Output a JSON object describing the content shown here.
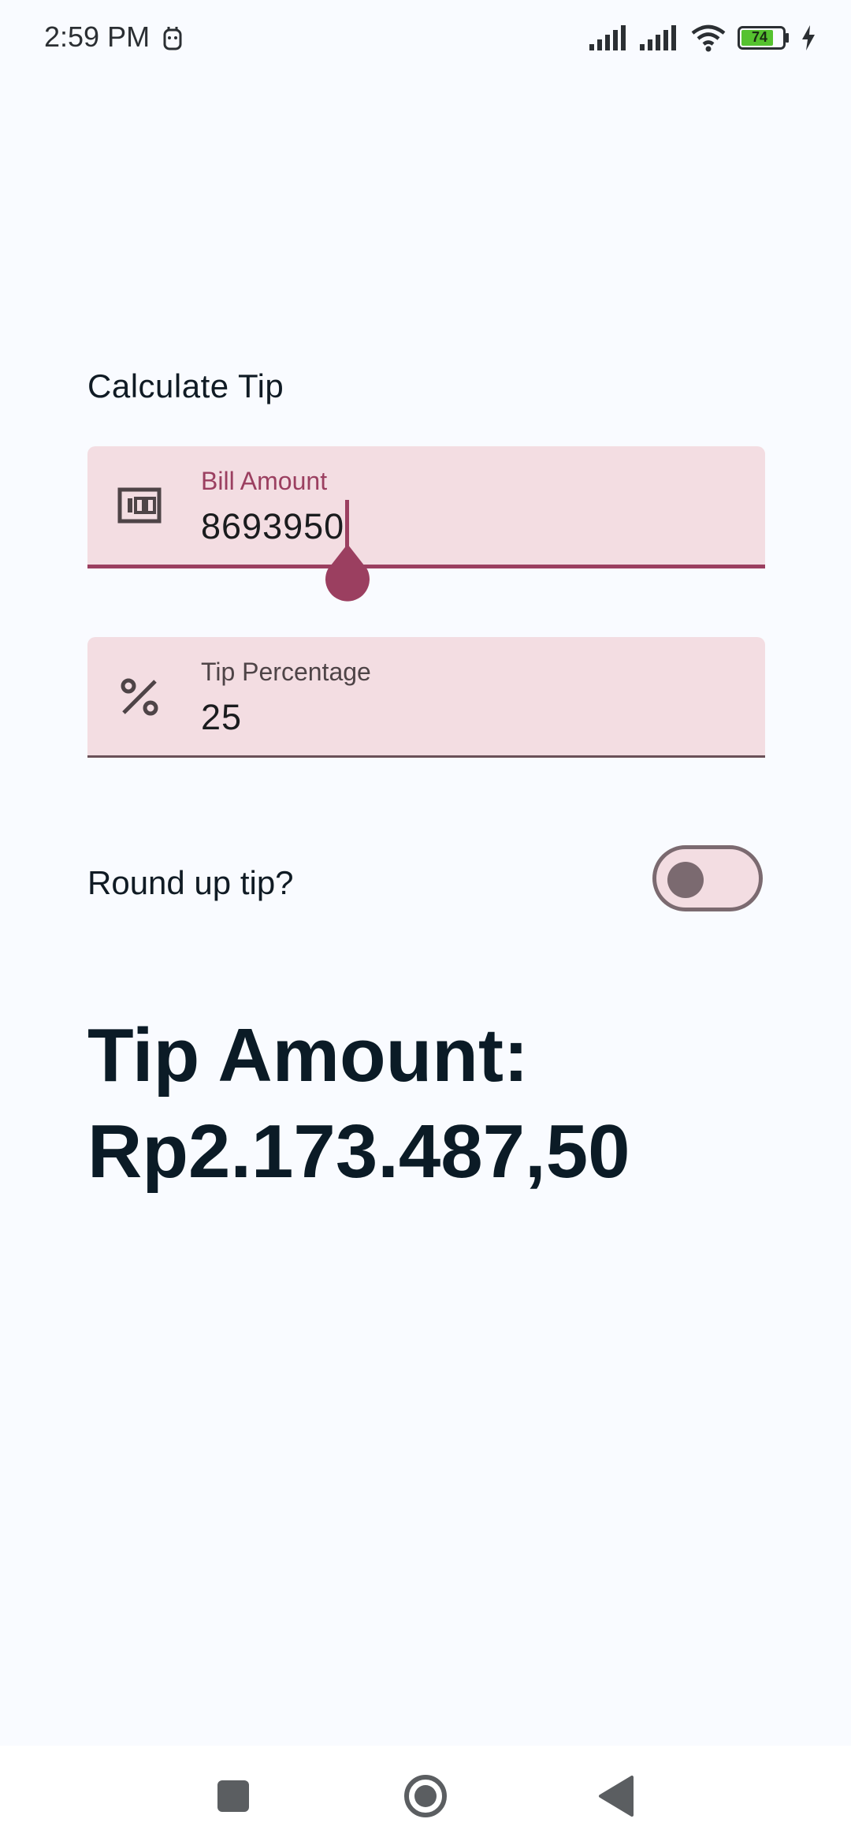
{
  "status_bar": {
    "time": "2:59 PM",
    "battery": "74"
  },
  "screen": {
    "title": "Calculate Tip"
  },
  "bill_field": {
    "label": "Bill Amount",
    "value": "8693950",
    "icon": "money-icon"
  },
  "tip_field": {
    "label": "Tip Percentage",
    "value": "25",
    "icon": "percent-icon"
  },
  "round_up": {
    "label": "Round up tip?",
    "enabled": false
  },
  "result": {
    "text": "Tip Amount: Rp2.173.487,50"
  },
  "colors": {
    "accent": "#9b3f60",
    "field_bg": "#f3dde2",
    "background": "#f9fbff"
  },
  "nav": {
    "icons": [
      "recent-apps-icon",
      "home-icon",
      "back-icon"
    ]
  }
}
